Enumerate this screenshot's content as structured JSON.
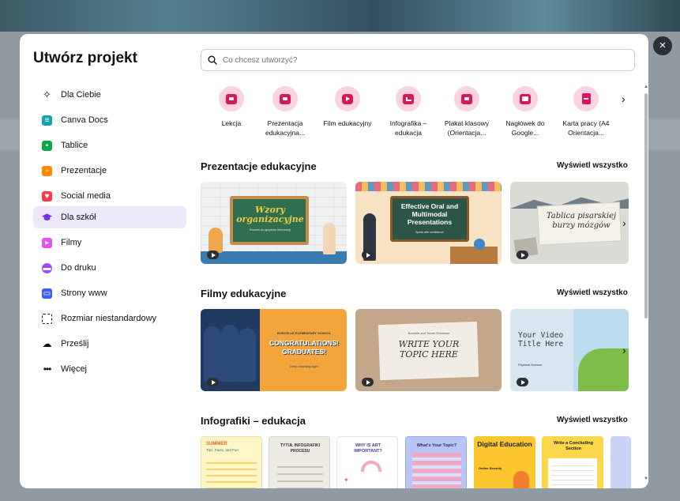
{
  "modal": {
    "title": "Utwórz projekt",
    "close_label": "×"
  },
  "sidebar": {
    "items": [
      {
        "label": "Dla Ciebie",
        "icon": "sparkle-icon",
        "color": "#0e1318"
      },
      {
        "label": "Canva Docs",
        "icon": "docs-icon",
        "color": "#13a3b5"
      },
      {
        "label": "Tablice",
        "icon": "whiteboard-icon",
        "color": "#0ba84a"
      },
      {
        "label": "Prezentacje",
        "icon": "presentation-icon",
        "color": "#ff8a00"
      },
      {
        "label": "Social media",
        "icon": "heart-icon",
        "color": "#ff3b4b"
      },
      {
        "label": "Dla szkół",
        "icon": "graduation-cap-icon",
        "color": "#7d2ae8"
      },
      {
        "label": "Filmy",
        "icon": "video-icon",
        "color": "#e950f7"
      },
      {
        "label": "Do druku",
        "icon": "print-icon",
        "color": "#9c4bf5"
      },
      {
        "label": "Strony www",
        "icon": "website-icon",
        "color": "#3f5ef9"
      },
      {
        "label": "Rozmiar niestandardowy",
        "icon": "custom-size-icon",
        "color": "#0e1318"
      },
      {
        "label": "Prześlij",
        "icon": "upload-icon",
        "color": "#0e1318"
      },
      {
        "label": "Więcej",
        "icon": "more-icon",
        "color": "#0e1318"
      }
    ],
    "active_index": 5
  },
  "search": {
    "placeholder": "Co chcesz utworzyć?"
  },
  "categories": [
    {
      "line1": "Lekcja",
      "line2": ""
    },
    {
      "line1": "Prezentacja",
      "line2": "edukacyjna..."
    },
    {
      "line1": "Film edukacyjny",
      "line2": ""
    },
    {
      "line1": "Infografika –",
      "line2": "edukacja"
    },
    {
      "line1": "Plakat klasowy",
      "line2": "(Orientacja..."
    },
    {
      "line1": "Nagłówek do",
      "line2": "Google..."
    },
    {
      "line1": "Karta pracy (A4",
      "line2": "Orientacja..."
    }
  ],
  "sections": {
    "presentations": {
      "title": "Prezentacje edukacyjne",
      "see_all": "Wyświetl wszystko",
      "cards": [
        {
          "title": "Wzory organizacyjne",
          "subtitle": "Rozwiń do języków informacji"
        },
        {
          "title": "Effective Oral and Multimodal Presentations",
          "subtitle": "Speak with confidence!"
        },
        {
          "title": "Tablica pisarskiej burzy mózgów",
          "subtitle": ""
        }
      ]
    },
    "videos": {
      "title": "Filmy edukacyjne",
      "see_all": "Wyświetl wszystko",
      "cards": [
        {
          "school": "BORCELLE ELEMENTARY SCHOOL",
          "title": "CONGRATULATIONS! GRADUATES!",
          "subtitle": "Keep reaching high!"
        },
        {
          "small": "Borcelle and Torren Robinson",
          "title": "WRITE YOUR TOPIC HERE"
        },
        {
          "title": "Your Video Title Here",
          "subtitle": "Physical Science"
        }
      ]
    },
    "infographics": {
      "title": "Infografiki – edukacja",
      "see_all": "Wyświetl wszystko",
      "cards": [
        {
          "title": "SUMMER",
          "subtitle": "Tips, Facts, and Fun"
        },
        {
          "title": "TYTUŁ INFOGRAFIKI PROCESU",
          "subtitle": ""
        },
        {
          "title": "WHY IS ART IMPORTANT?",
          "subtitle": ""
        },
        {
          "title": "What's Your Topic?",
          "subtitle": ""
        },
        {
          "title": "Digital Education",
          "subtitle": "Online Security"
        },
        {
          "title": "Write a Concluding Section",
          "subtitle": ""
        },
        {
          "title": "",
          "subtitle": ""
        }
      ]
    }
  },
  "colors": {
    "accent": "#7d2ae8",
    "active_bg": "#ede9fb",
    "category_circle": "#fbd3e0",
    "category_icon": "#d6175c"
  }
}
